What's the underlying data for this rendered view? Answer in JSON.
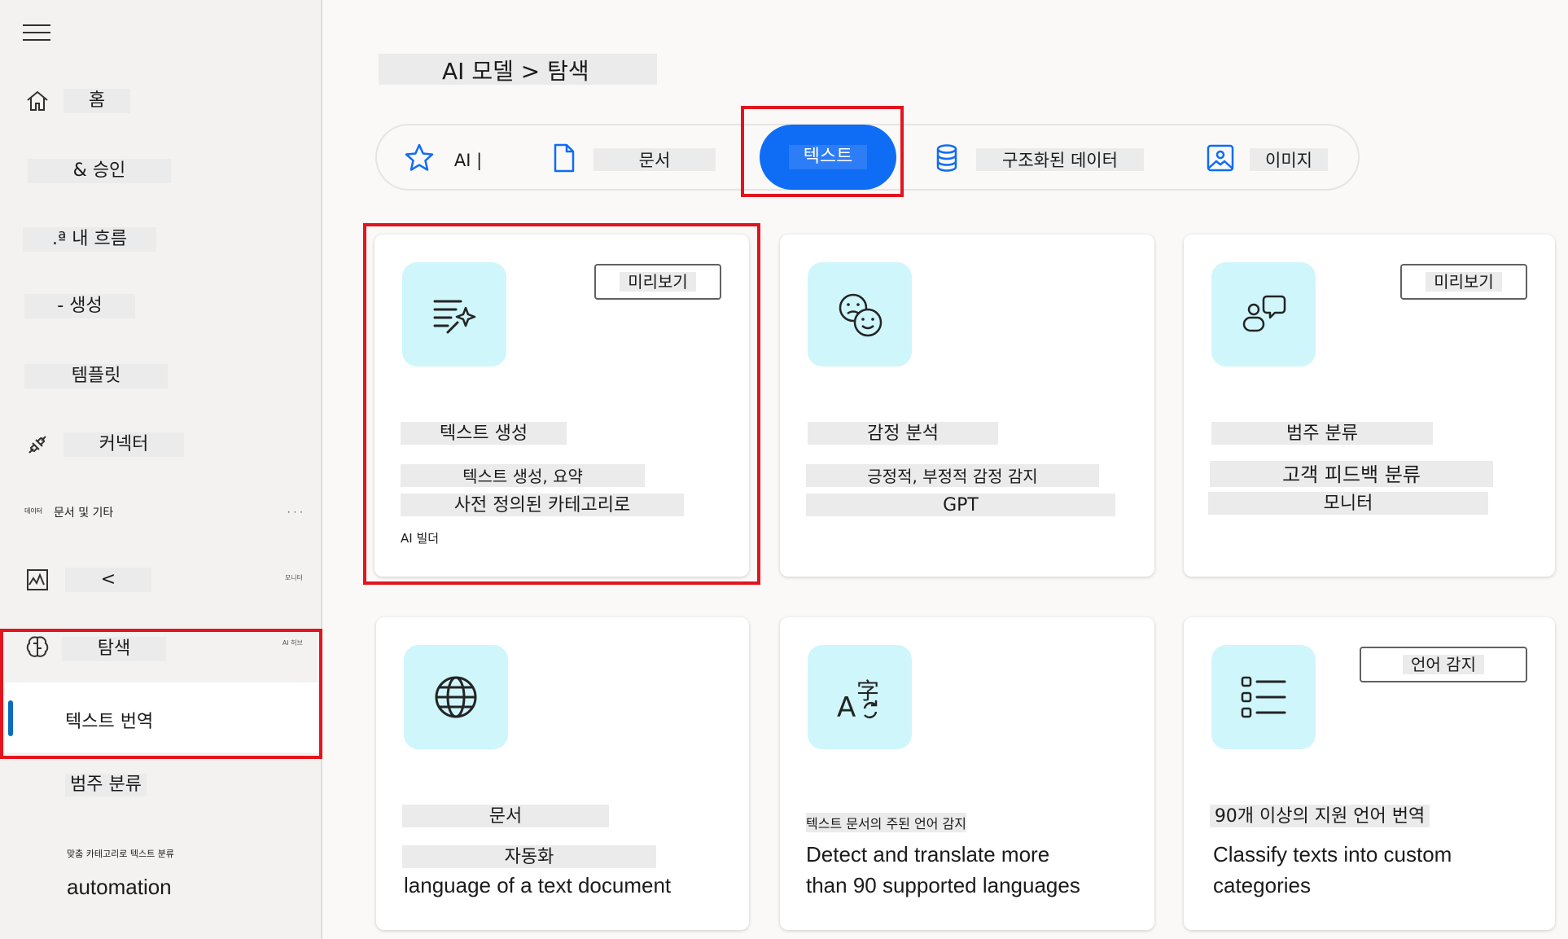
{
  "sidebar": {
    "items": [
      {
        "label": "홈",
        "icon": "home-icon"
      },
      {
        "label": "& 승인"
      },
      {
        "label": ".ª 내 흐름"
      },
      {
        "label": "- 생성"
      },
      {
        "label": "템플릿"
      },
      {
        "label": "커넥터",
        "icon": "connector-icon"
      },
      {
        "label": "문서 및 기타",
        "prefix": "데이터",
        "extra": "· · ·"
      },
      {
        "label": "<",
        "icon": "monitor-icon",
        "extra": "모니터"
      },
      {
        "label": "탐색",
        "icon": "brain-icon",
        "extra": "AI 허브"
      }
    ],
    "sub_items": [
      {
        "label": "텍스트 번역"
      },
      {
        "label": "범주 분류"
      },
      {
        "label": "맞춤 카테고리로 텍스트 분류"
      },
      {
        "label": "automation"
      }
    ]
  },
  "header": {
    "title": "AI 모델 > 탐색"
  },
  "tabs": [
    {
      "label": "AI |",
      "icon": "star-icon"
    },
    {
      "label": "문서",
      "icon": "document-icon"
    },
    {
      "label": "텍스트",
      "active": true
    },
    {
      "label": "구조화된 데이터",
      "icon": "database-icon"
    },
    {
      "label": "이미지",
      "icon": "image-icon"
    }
  ],
  "cards": [
    {
      "icon": "text-sparkle-icon",
      "badge": "미리보기",
      "title": "텍스트 생성",
      "line1": "텍스트 생성, 요약",
      "line2": "사전 정의된 카테고리로",
      "footer": "AI 빌더"
    },
    {
      "icon": "emoji-icon",
      "title": "감정 분석",
      "line1": "긍정적, 부정적 감정 감지",
      "line2": "GPT"
    },
    {
      "icon": "chat-person-icon",
      "badge": "미리보기",
      "title": "범주 분류",
      "line1": "고객 피드백 분류",
      "line2": "모니터"
    },
    {
      "icon": "globe-icon",
      "title": "문서",
      "line1": "자동화",
      "line2": "language of a text document"
    },
    {
      "icon": "translate-icon",
      "title": "텍스트 문서의 주된 언어 감지",
      "line1": "Detect and translate more",
      "line2": "than 90 supported languages"
    },
    {
      "icon": "list-icon",
      "badge": "언어 감지",
      "title": "90개 이상의 지원 언어 번역",
      "line1": "Classify texts into custom",
      "line2": "categories"
    }
  ],
  "colors": {
    "accent": "#0f6cf5",
    "highlight": "#e3141e",
    "icon_bg": "#cff6fb"
  }
}
